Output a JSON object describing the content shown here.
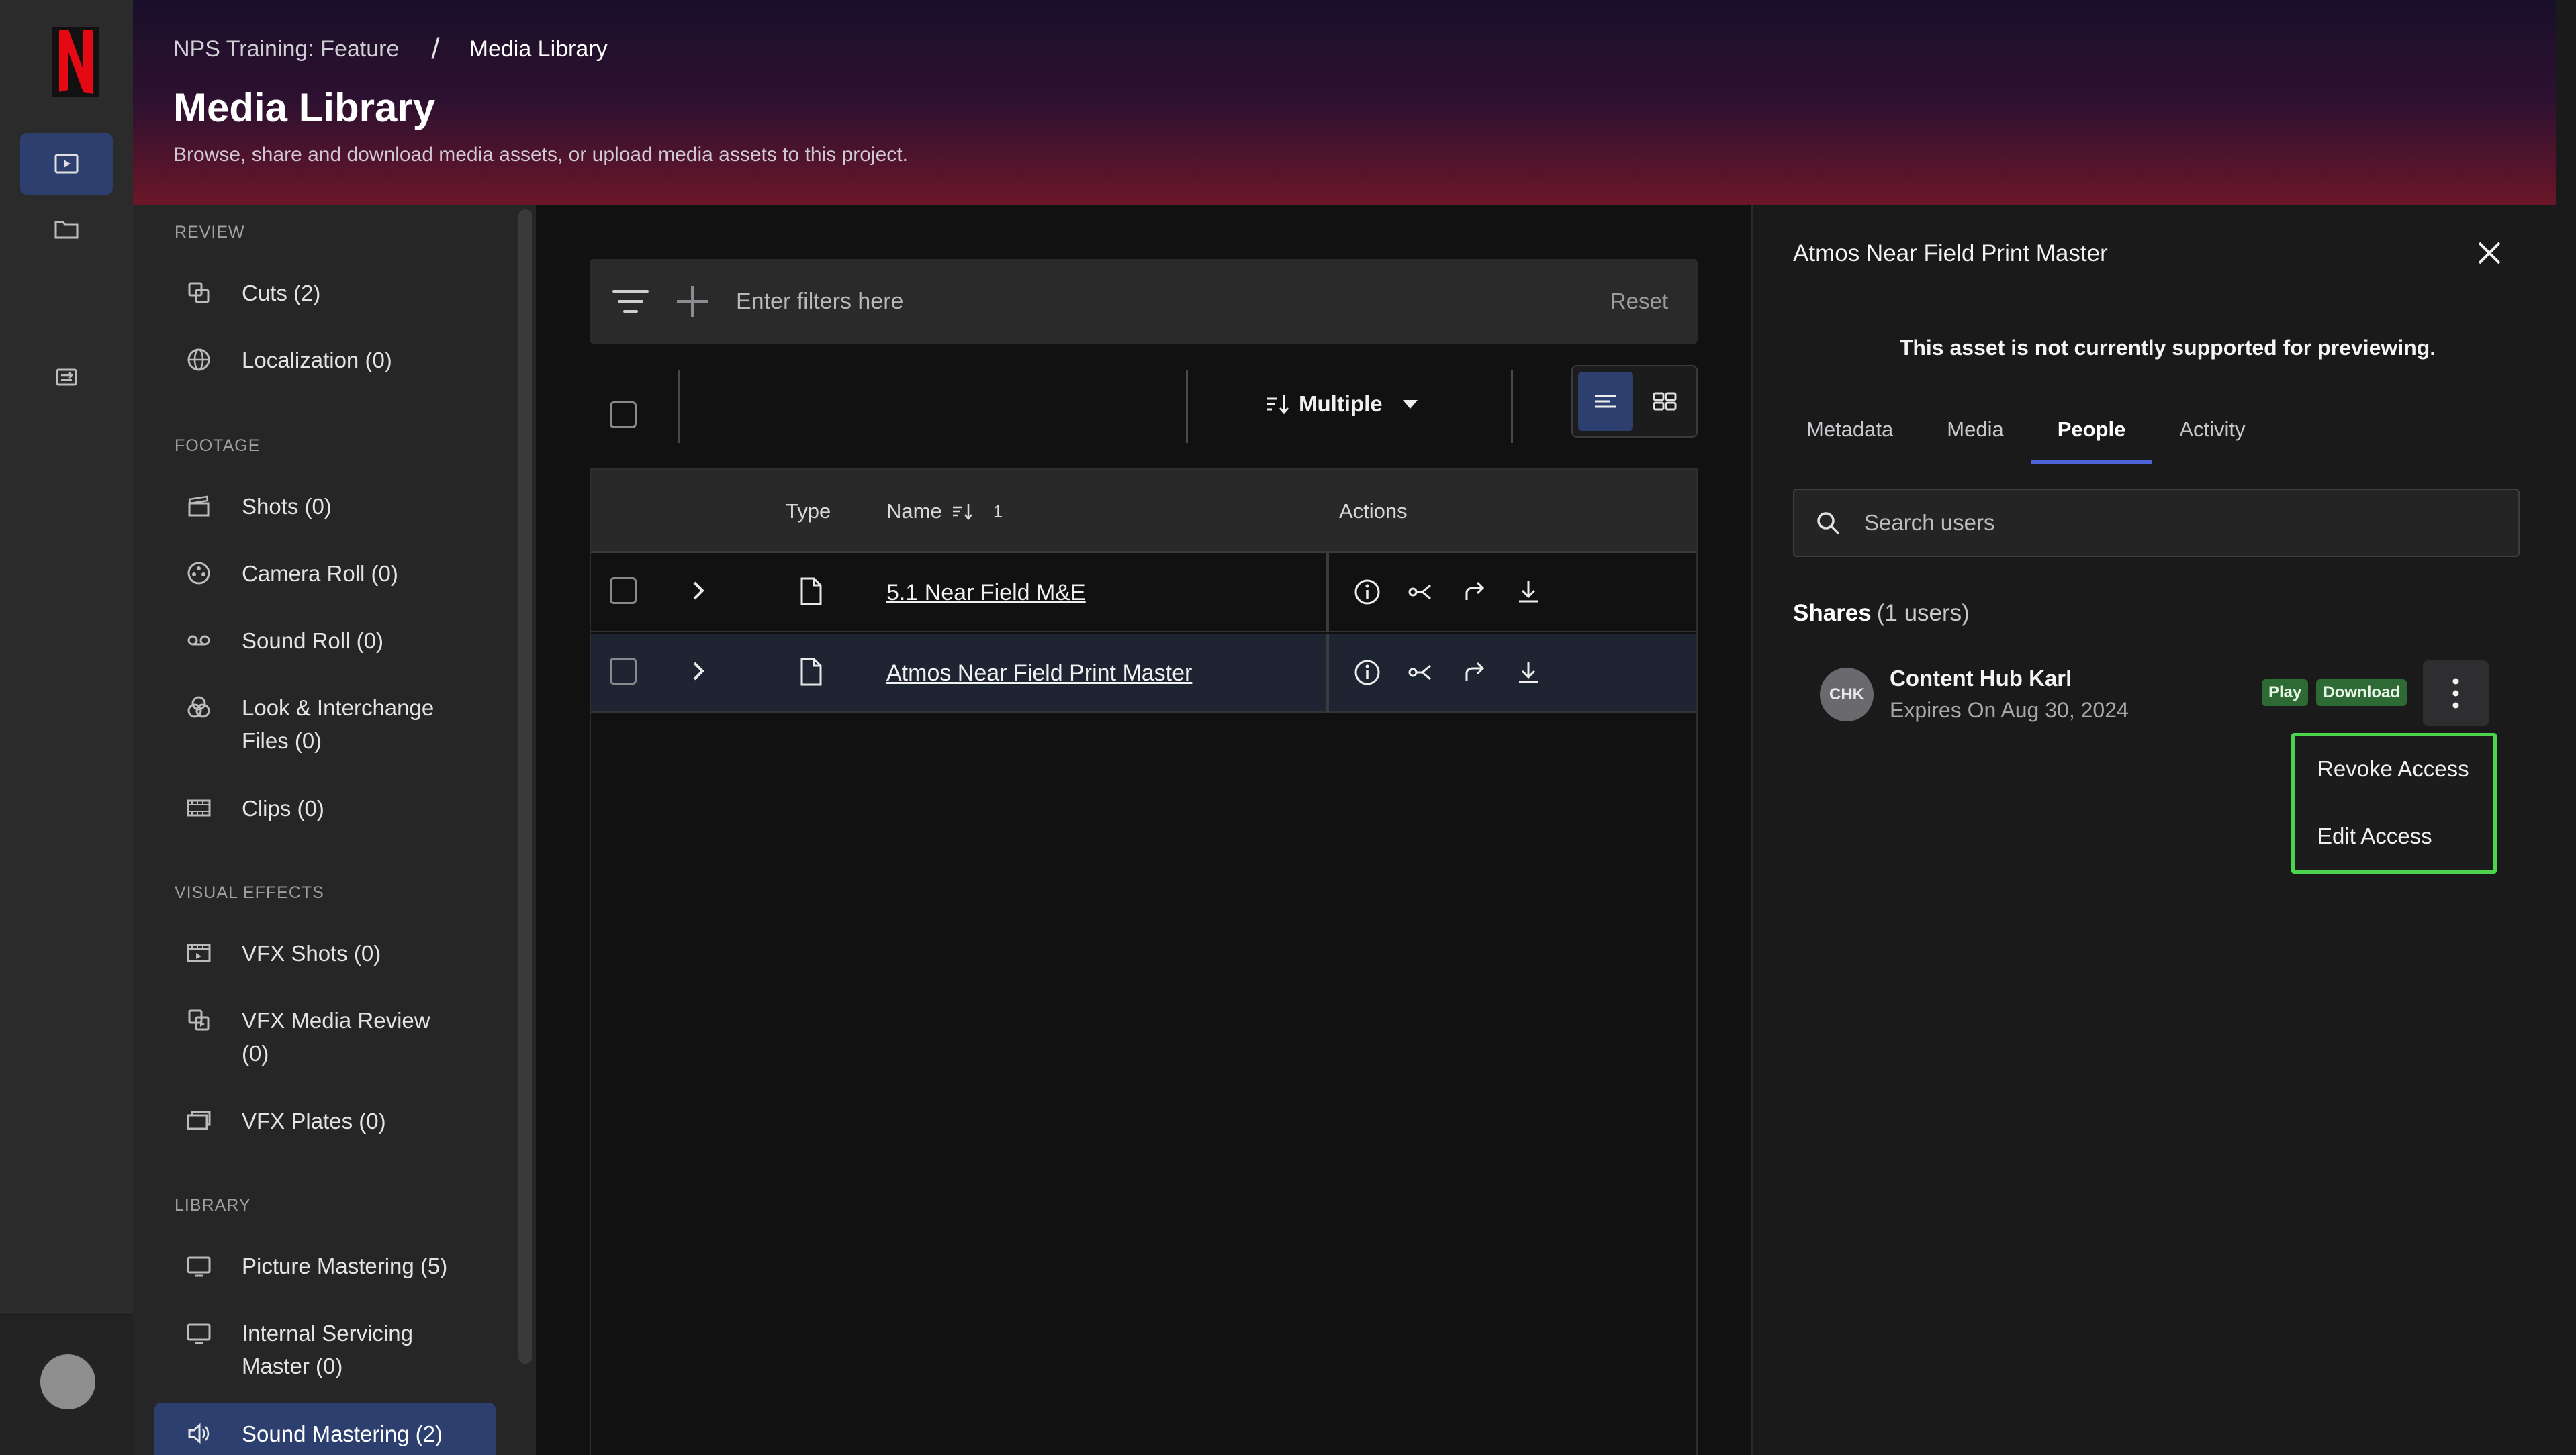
{
  "breadcrumb": {
    "root": "NPS Training: Feature",
    "separator": "/",
    "current": "Media Library"
  },
  "header": {
    "title": "Media Library",
    "subtitle": "Browse, share and download media assets, or upload media assets to this project."
  },
  "rail": {
    "logo": "N",
    "items": [
      {
        "icon": "play-square-icon",
        "active": true
      },
      {
        "icon": "folder-icon",
        "active": false
      },
      {
        "icon": "transfer-icon",
        "active": false
      }
    ]
  },
  "nav": {
    "sections": [
      {
        "label": "REVIEW",
        "items": [
          {
            "label": "Cuts (2)",
            "icon": "cuts-icon"
          },
          {
            "label": "Localization (0)",
            "icon": "globe-icon"
          }
        ]
      },
      {
        "label": "FOOTAGE",
        "items": [
          {
            "label": "Shots (0)",
            "icon": "clapper-icon"
          },
          {
            "label": "Camera Roll (0)",
            "icon": "film-reel-icon"
          },
          {
            "label": "Sound Roll (0)",
            "icon": "tape-icon"
          },
          {
            "label": "Look & Interchange Files (0)",
            "icon": "color-circles-icon"
          },
          {
            "label": "Clips (0)",
            "icon": "filmstrip-icon"
          }
        ]
      },
      {
        "label": "VISUAL EFFECTS",
        "items": [
          {
            "label": "VFX Shots (0)",
            "icon": "vfx-film-icon"
          },
          {
            "label": "VFX Media Review (0)",
            "icon": "vfx-review-icon"
          },
          {
            "label": "VFX Plates (0)",
            "icon": "plates-icon"
          }
        ]
      },
      {
        "label": "LIBRARY",
        "items": [
          {
            "label": "Picture Mastering (5)",
            "icon": "monitor-icon"
          },
          {
            "label": "Internal Servicing Master (0)",
            "icon": "monitor-icon"
          },
          {
            "label": "Sound Mastering (2)",
            "icon": "speaker-icon",
            "active": true
          }
        ]
      }
    ]
  },
  "filter": {
    "placeholder": "Enter filters here",
    "reset": "Reset"
  },
  "toolbar": {
    "sort_label": "Multiple"
  },
  "table": {
    "columns": {
      "type": "Type",
      "name": "Name",
      "name_sort": "1",
      "actions": "Actions"
    },
    "rows": [
      {
        "name": "5.1 Near Field M&E",
        "selected": false
      },
      {
        "name": "Atmos Near Field Print Master",
        "selected": true
      }
    ]
  },
  "panel": {
    "title": "Atmos Near Field Print Master",
    "note": "This asset is not currently supported for previewing.",
    "tabs": [
      "Metadata",
      "Media",
      "People",
      "Activity"
    ],
    "active_tab": "People",
    "search_placeholder": "Search users",
    "shares_label": "Shares",
    "shares_count": "(1 users)",
    "user": {
      "initials": "CHK",
      "name": "Content Hub Karl",
      "expires": "Expires On Aug 30, 2024",
      "badges": [
        "Play",
        "Download"
      ]
    },
    "menu": [
      "Revoke Access",
      "Edit Access"
    ]
  },
  "colors": {
    "accent": "#2d3f6e",
    "tab_underline": "#4c63d9",
    "badge": "#2e6b34",
    "menu_outline": "#4cd44c",
    "brand": "#e50914"
  }
}
